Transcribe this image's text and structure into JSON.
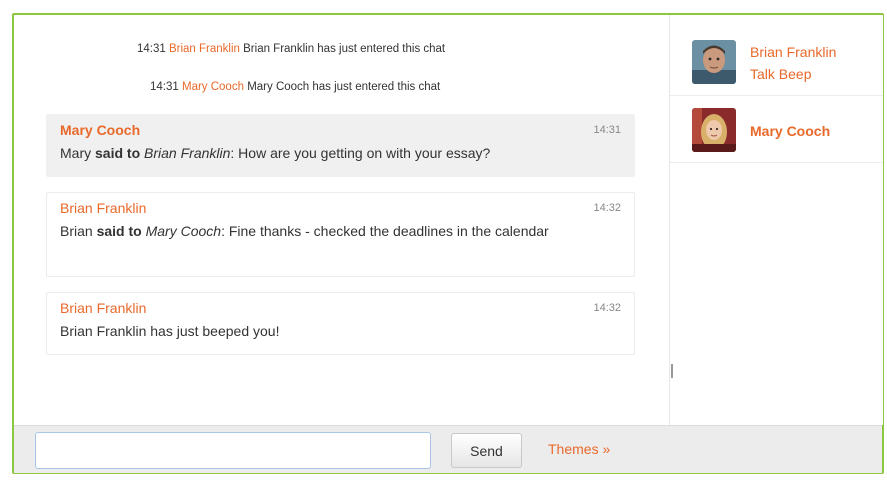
{
  "system_messages": [
    {
      "time": "14:31",
      "user": "Brian Franklin",
      "text": "Brian Franklin has just entered this chat"
    },
    {
      "time": "14:31",
      "user": "Mary Cooch",
      "text": "Mary Cooch has just entered this chat"
    }
  ],
  "messages": [
    {
      "sender": "Mary Cooch",
      "time": "14:31",
      "speaker": "Mary",
      "said_to": "said to",
      "recipient": "Brian Franklin",
      "text": ": How are you getting on with your essay?"
    },
    {
      "sender": "Brian Franklin",
      "time": "14:32",
      "speaker": "Brian",
      "said_to": "said to",
      "recipient": "Mary Cooch",
      "text": ": Fine thanks - checked the deadlines in the calendar"
    },
    {
      "sender": "Brian Franklin",
      "time": "14:32",
      "text": "Brian Franklin has just beeped you!"
    }
  ],
  "users": [
    {
      "name": "Brian Franklin",
      "action": "Talk Beep"
    },
    {
      "name": "Mary Cooch"
    }
  ],
  "input": {
    "value": "",
    "placeholder": ""
  },
  "send_label": "Send",
  "themes_label": "Themes »",
  "colors": {
    "accent": "#e8692a",
    "border": "#8dc63f"
  }
}
